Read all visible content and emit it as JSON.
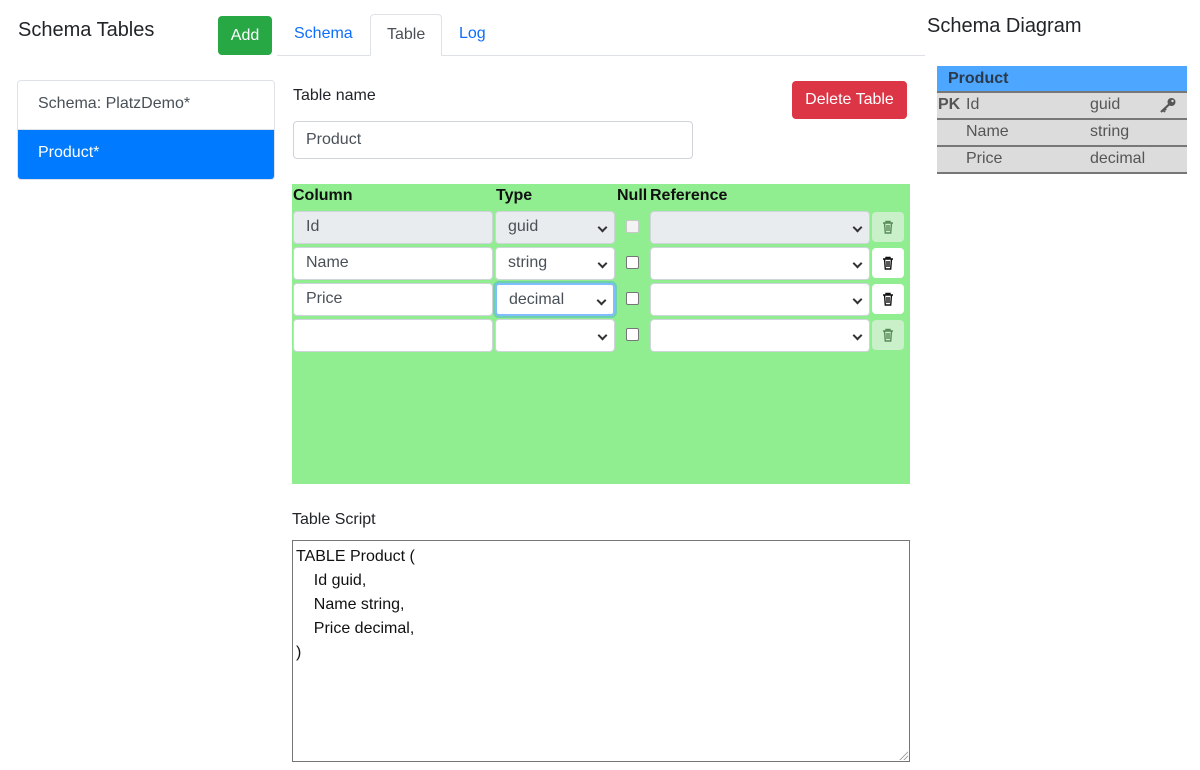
{
  "left": {
    "title": "Schema Tables",
    "add_label": "Add",
    "items": [
      {
        "label": "Schema: PlatzDemo*",
        "active": false
      },
      {
        "label": "Product*",
        "active": true
      }
    ]
  },
  "tabs": [
    {
      "label": "Schema",
      "active": false
    },
    {
      "label": "Table",
      "active": true
    },
    {
      "label": "Log",
      "active": false
    }
  ],
  "table": {
    "name_label": "Table name",
    "name_value": "Product",
    "delete_label": "Delete Table",
    "headers": {
      "column": "Column",
      "type": "Type",
      "null": "Null",
      "reference": "Reference"
    },
    "rows": [
      {
        "column": "Id",
        "type": "guid",
        "null": false,
        "reference": ""
      },
      {
        "column": "Name",
        "type": "string",
        "null": false,
        "reference": ""
      },
      {
        "column": "Price",
        "type": "decimal",
        "null": false,
        "reference": ""
      },
      {
        "column": "",
        "type": "",
        "null": false,
        "reference": ""
      }
    ]
  },
  "script": {
    "label": "Table Script",
    "content": "TABLE Product (\n    Id guid,\n    Name string,\n    Price decimal,\n)"
  },
  "diagram": {
    "title": "Schema Diagram",
    "table_name": "Product",
    "pk_label": "PK",
    "rows": [
      {
        "name": "Id",
        "type": "guid"
      },
      {
        "name": "Name",
        "type": "string"
      },
      {
        "name": "Price",
        "type": "decimal"
      }
    ]
  },
  "colors": {
    "primary": "#007bff",
    "success": "#28a745",
    "danger": "#dc3545",
    "columns_bg": "#90ee90",
    "diagram_header": "#4da6ff"
  }
}
